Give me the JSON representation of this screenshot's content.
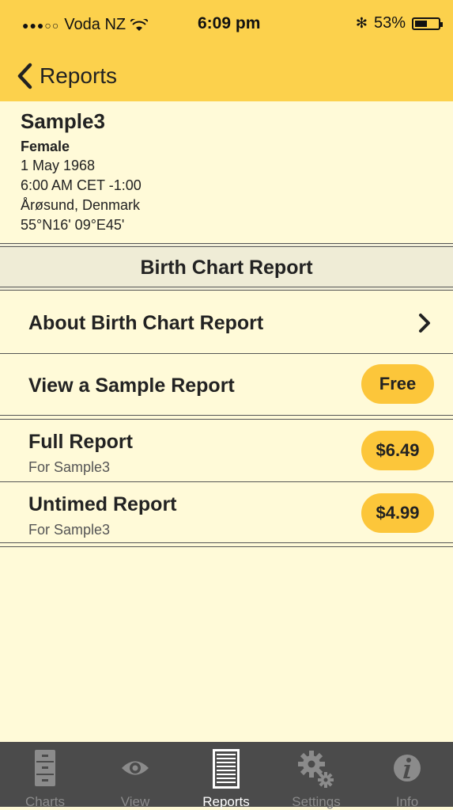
{
  "status_bar": {
    "signal_dots": "●●●○○",
    "carrier": "Voda NZ",
    "time": "6:09 pm",
    "bluetooth": "✻",
    "battery_percent": "53%",
    "battery_level": 0.53
  },
  "nav": {
    "back_label": "Reports"
  },
  "profile": {
    "name": "Sample3",
    "sex": "Female",
    "date": "1 May 1968",
    "time": "6:00 AM CET -1:00",
    "place": "Årøsund, Denmark",
    "coords": "55°N16' 09°E45'"
  },
  "section_title": "Birth Chart Report",
  "rows": {
    "about": {
      "label": "About Birth Chart Report"
    },
    "sample": {
      "label": "View a Sample Report",
      "price": "Free"
    },
    "full": {
      "label": "Full Report",
      "sub": "For Sample3",
      "price": "$6.49"
    },
    "untimed": {
      "label": "Untimed Report",
      "sub": "For Sample3",
      "price": "$4.99"
    }
  },
  "tabs": [
    {
      "label": "Charts",
      "icon": "cabinet-icon"
    },
    {
      "label": "View",
      "icon": "eye-icon"
    },
    {
      "label": "Reports",
      "icon": "document-icon",
      "active": true
    },
    {
      "label": "Settings",
      "icon": "gears-icon"
    },
    {
      "label": "Info",
      "icon": "info-icon"
    }
  ],
  "colors": {
    "header": "#fcd14c",
    "background": "#fffad8",
    "pill": "#fcc63a",
    "tabbar": "#4b4b4b"
  }
}
